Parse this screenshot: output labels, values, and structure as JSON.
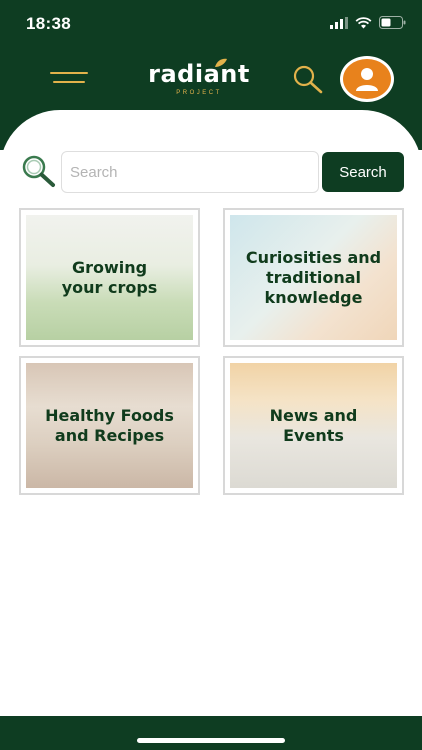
{
  "status_bar": {
    "time": "18:38"
  },
  "header": {
    "logo_text": "radiant",
    "logo_subtext": "PROJECT"
  },
  "search": {
    "placeholder": "Search",
    "value": "",
    "button_label": "Search"
  },
  "cards": [
    {
      "label_line1": "Growing",
      "label_line2": "your crops"
    },
    {
      "label_line1": "Curiosities and",
      "label_line2": "traditional",
      "label_line3": "knowledge"
    },
    {
      "label_line1": "Healthy Foods",
      "label_line2": "and Recipes"
    },
    {
      "label_line1": "News and",
      "label_line2": "Events"
    }
  ],
  "colors": {
    "brand_dark_green": "#0e3d22",
    "accent_gold": "#e2b24b",
    "avatar_orange": "#e8821c",
    "card_text_green": "#103b1c"
  },
  "icons": [
    "menu-icon",
    "search-icon",
    "user-icon",
    "signal-icon",
    "wifi-icon",
    "battery-icon"
  ]
}
